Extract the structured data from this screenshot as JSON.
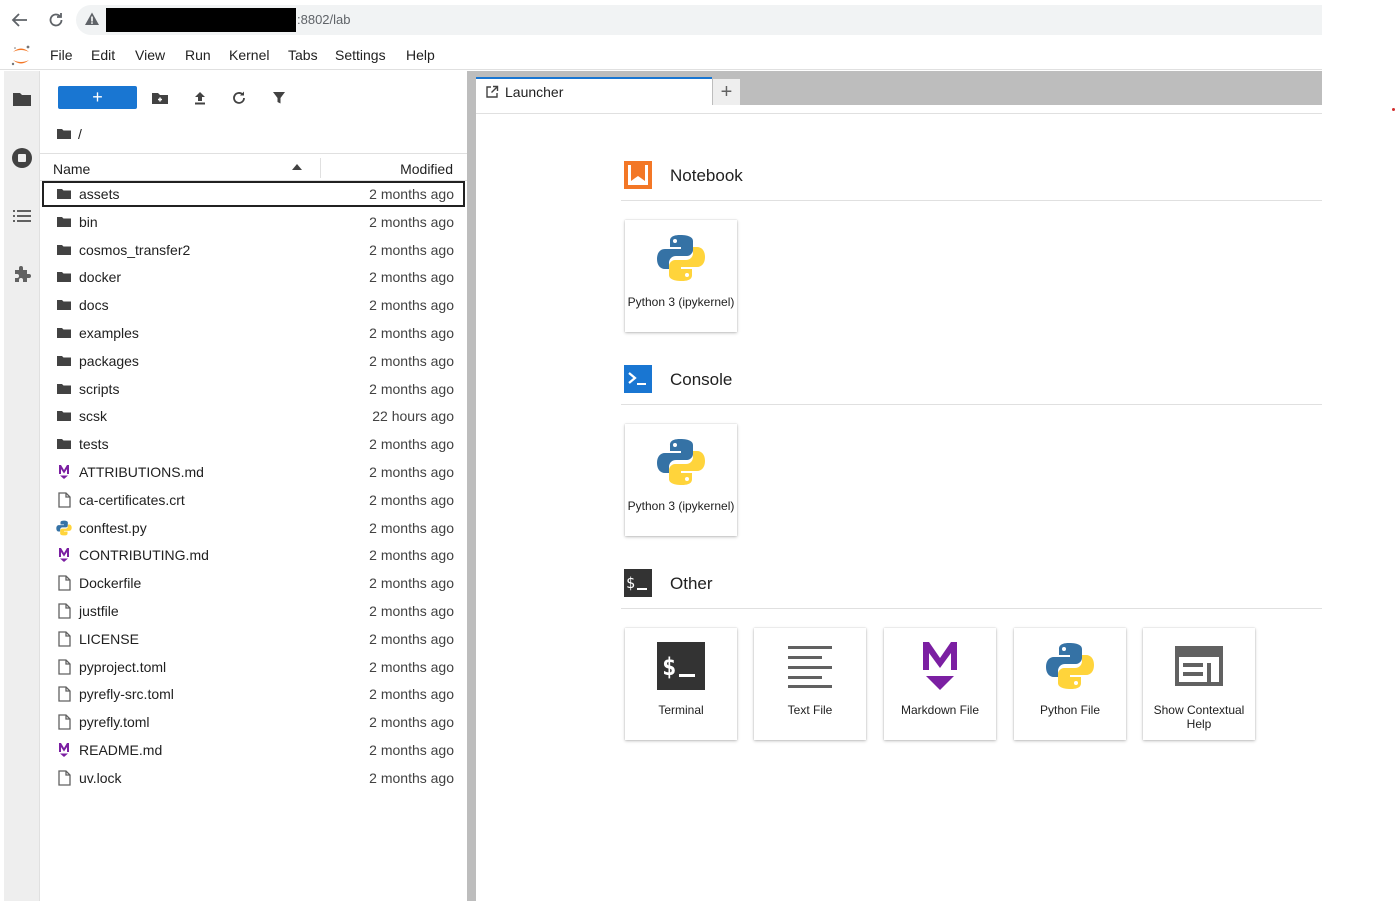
{
  "browser": {
    "url_text": ":8802/lab"
  },
  "menubar": {
    "items": [
      {
        "label": "File"
      },
      {
        "label": "Edit"
      },
      {
        "label": "View"
      },
      {
        "label": "Run"
      },
      {
        "label": "Kernel"
      },
      {
        "label": "Tabs"
      },
      {
        "label": "Settings"
      },
      {
        "label": "Help"
      }
    ]
  },
  "sidebar": {
    "icons": [
      "folder-icon",
      "running-icon",
      "toc-icon",
      "extension-icon"
    ]
  },
  "filebrowser": {
    "new_button": "+",
    "breadcrumb": "/",
    "columns": {
      "name": "Name",
      "modified": "Modified"
    },
    "files": [
      {
        "name": "assets",
        "modified": "2 months ago",
        "type": "folder"
      },
      {
        "name": "bin",
        "modified": "2 months ago",
        "type": "folder"
      },
      {
        "name": "cosmos_transfer2",
        "modified": "2 months ago",
        "type": "folder"
      },
      {
        "name": "docker",
        "modified": "2 months ago",
        "type": "folder"
      },
      {
        "name": "docs",
        "modified": "2 months ago",
        "type": "folder"
      },
      {
        "name": "examples",
        "modified": "2 months ago",
        "type": "folder"
      },
      {
        "name": "packages",
        "modified": "2 months ago",
        "type": "folder"
      },
      {
        "name": "scripts",
        "modified": "2 months ago",
        "type": "folder"
      },
      {
        "name": "scsk",
        "modified": "22 hours ago",
        "type": "folder"
      },
      {
        "name": "tests",
        "modified": "2 months ago",
        "type": "folder"
      },
      {
        "name": "ATTRIBUTIONS.md",
        "modified": "2 months ago",
        "type": "markdown"
      },
      {
        "name": "ca-certificates.crt",
        "modified": "2 months ago",
        "type": "file"
      },
      {
        "name": "conftest.py",
        "modified": "2 months ago",
        "type": "python"
      },
      {
        "name": "CONTRIBUTING.md",
        "modified": "2 months ago",
        "type": "markdown"
      },
      {
        "name": "Dockerfile",
        "modified": "2 months ago",
        "type": "file"
      },
      {
        "name": "justfile",
        "modified": "2 months ago",
        "type": "file"
      },
      {
        "name": "LICENSE",
        "modified": "2 months ago",
        "type": "file"
      },
      {
        "name": "pyproject.toml",
        "modified": "2 months ago",
        "type": "file"
      },
      {
        "name": "pyrefly-src.toml",
        "modified": "2 months ago",
        "type": "file"
      },
      {
        "name": "pyrefly.toml",
        "modified": "2 months ago",
        "type": "file"
      },
      {
        "name": "README.md",
        "modified": "2 months ago",
        "type": "markdown"
      },
      {
        "name": "uv.lock",
        "modified": "2 months ago",
        "type": "file"
      }
    ]
  },
  "tabs": {
    "launcher_label": "Launcher",
    "add_label": "+"
  },
  "launcher": {
    "notebook": {
      "title": "Notebook",
      "cards": [
        {
          "label": "Python 3 (ipykernel)",
          "icon": "python-icon"
        }
      ]
    },
    "console": {
      "title": "Console",
      "cards": [
        {
          "label": "Python 3 (ipykernel)",
          "icon": "python-icon"
        }
      ]
    },
    "other": {
      "title": "Other",
      "cards": [
        {
          "label": "Terminal",
          "icon": "terminal-icon"
        },
        {
          "label": "Text File",
          "icon": "text-file-icon"
        },
        {
          "label": "Markdown File",
          "icon": "markdown-icon"
        },
        {
          "label": "Python File",
          "icon": "python-icon"
        },
        {
          "label": "Show Contextual Help",
          "icon": "contextual-help-icon"
        }
      ]
    }
  },
  "colors": {
    "accent": "#1976d2",
    "notebook_orange": "#f37726",
    "markdown_purple": "#7b1fa2",
    "python_blue": "#3572a5",
    "python_yellow": "#ffd43b"
  }
}
